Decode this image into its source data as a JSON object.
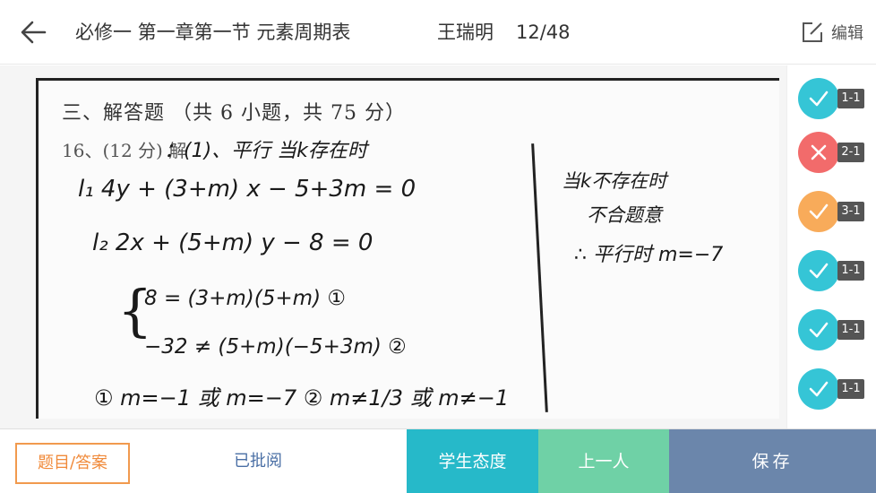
{
  "header": {
    "title": "必修一 第一章第一节 元素周期表",
    "student": "王瑞明",
    "progress": "12/48",
    "edit_label": "编辑"
  },
  "sheet": {
    "heading": "三、解答题 （共 6 小题，共 75 分）",
    "question_number": "16、(12 分) 解",
    "handwriting": {
      "start": "：(1)、平行  当k存在时",
      "line1": "l₁  4y + (3+m) x − 5+3m = 0",
      "line2": "l₂  2x + (5+m) y − 8 = 0",
      "eq1": "8 = (3+m)(5+m)  ①",
      "eq2": "−32 ≠ (5+m)(−5+3m)  ②",
      "solution": "① m=−1 或 m=−7     ② m≠1/3 或 m≠−1",
      "right1": "当k不存在时",
      "right2": "不合题意",
      "right3": "∴ 平行时 m=−7"
    }
  },
  "score_marks": [
    {
      "label": "1-1",
      "status": "correct",
      "color": "#35c5d6"
    },
    {
      "label": "2-1",
      "status": "wrong",
      "color": "#f26b6b"
    },
    {
      "label": "3-1",
      "status": "partial",
      "color": "#f8ab5a"
    },
    {
      "label": "1-1",
      "status": "correct",
      "color": "#35c5d6"
    },
    {
      "label": "1-1",
      "status": "correct",
      "color": "#35c5d6"
    },
    {
      "label": "1-1",
      "status": "correct",
      "color": "#35c5d6"
    }
  ],
  "toolbar": {
    "question_answer_label": "题目/答案",
    "reviewed_label": "已批阅",
    "attitude_label": "学生态度",
    "prev_label": "上一人",
    "save_label": "保存"
  },
  "colors": {
    "accent_orange": "#f08a3a",
    "attitude_bg": "#26b9c9",
    "prev_bg": "#6fd1a6",
    "save_bg": "#6b86ab"
  }
}
